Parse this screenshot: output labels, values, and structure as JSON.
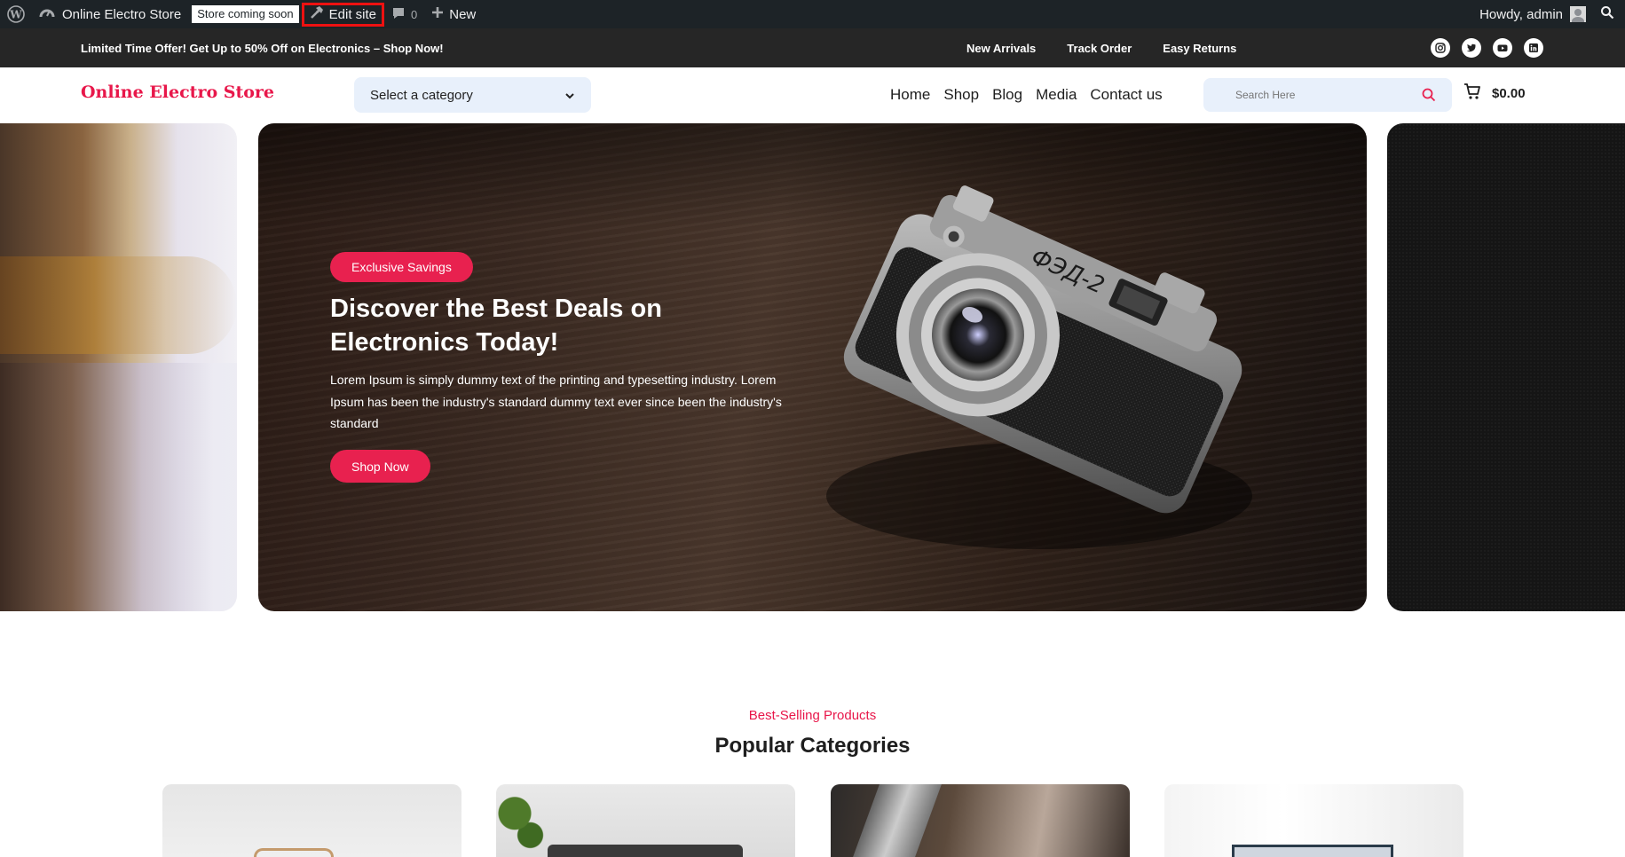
{
  "adminbar": {
    "site_name": "Online Electro Store",
    "store_badge": "Store coming soon",
    "edit_site": "Edit site",
    "comments_count": "0",
    "new_label": "New",
    "howdy": "Howdy, admin"
  },
  "promo": {
    "offer_text": "Limited Time Offer! Get Up to 50% Off on Electronics – Shop Now!",
    "links": [
      "New Arrivals",
      "Track Order",
      "Easy Returns"
    ],
    "social_icons": [
      "instagram-icon",
      "twitter-icon",
      "youtube-icon",
      "linkedin-icon"
    ]
  },
  "header": {
    "logo": "Online Electro Store",
    "category_select": "Select a category",
    "nav": [
      "Home",
      "Shop",
      "Blog",
      "Media",
      "Contact us"
    ],
    "search_placeholder": "Search Here",
    "cart_total": "$0.00"
  },
  "hero": {
    "badge": "Exclusive Savings",
    "title": "Discover the Best Deals on Electronics Today!",
    "description": "Lorem Ipsum is simply dummy text of the printing and typesetting industry. Lorem Ipsum has been the industry's standard dummy text ever since been the industry's standard",
    "button": "Shop Now"
  },
  "categories": {
    "eyebrow": "Best-Selling Products",
    "title": "Popular Categories"
  },
  "colors": {
    "accent": "#e8214f",
    "adminbar": "#1d2327",
    "promobar": "#262626",
    "field_bg": "#e8f0fb"
  }
}
